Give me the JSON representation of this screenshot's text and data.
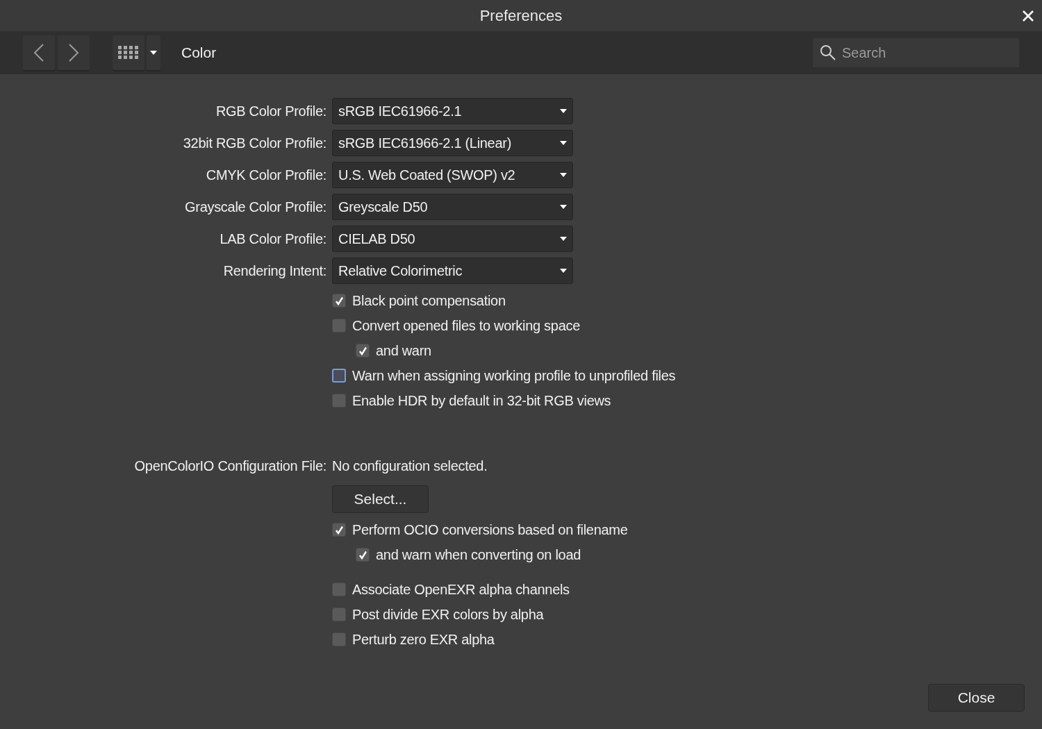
{
  "window": {
    "title": "Preferences"
  },
  "toolbar": {
    "section": "Color",
    "search": {
      "placeholder": "Search"
    }
  },
  "profiles": [
    {
      "label": "RGB Color Profile:",
      "value": "sRGB IEC61966-2.1"
    },
    {
      "label": "32bit RGB Color Profile:",
      "value": "sRGB IEC61966-2.1 (Linear)"
    },
    {
      "label": "CMYK Color Profile:",
      "value": "U.S. Web Coated (SWOP) v2"
    },
    {
      "label": "Grayscale Color Profile:",
      "value": "Greyscale D50"
    },
    {
      "label": "LAB Color Profile:",
      "value": "CIELAB D50"
    },
    {
      "label": "Rendering Intent:",
      "value": "Relative Colorimetric"
    }
  ],
  "options": [
    {
      "label": "Black point compensation",
      "checked": true,
      "focused": false
    },
    {
      "label": "Convert opened files to working space",
      "checked": false,
      "focused": false,
      "children": [
        {
          "label": "and warn",
          "checked": true,
          "focused": false
        }
      ]
    },
    {
      "label": "Warn when assigning working profile to unprofiled files",
      "checked": false,
      "focused": true
    },
    {
      "label": "Enable HDR by default in 32-bit RGB views",
      "checked": false,
      "focused": false
    }
  ],
  "ocio": {
    "label": "OpenColorIO Configuration File:",
    "value": "No configuration selected.",
    "button": "Select...",
    "options": [
      {
        "label": "Perform OCIO conversions based on filename",
        "checked": true,
        "focused": false,
        "children": [
          {
            "label": "and warn when converting on load",
            "checked": true,
            "focused": false
          }
        ]
      }
    ]
  },
  "exr_options": [
    {
      "label": "Associate OpenEXR alpha channels",
      "checked": false,
      "focused": false
    },
    {
      "label": "Post divide EXR colors by alpha",
      "checked": false,
      "focused": false
    },
    {
      "label": "Perturb zero EXR alpha",
      "checked": false,
      "focused": false
    }
  ],
  "buttons": [
    "Close"
  ]
}
